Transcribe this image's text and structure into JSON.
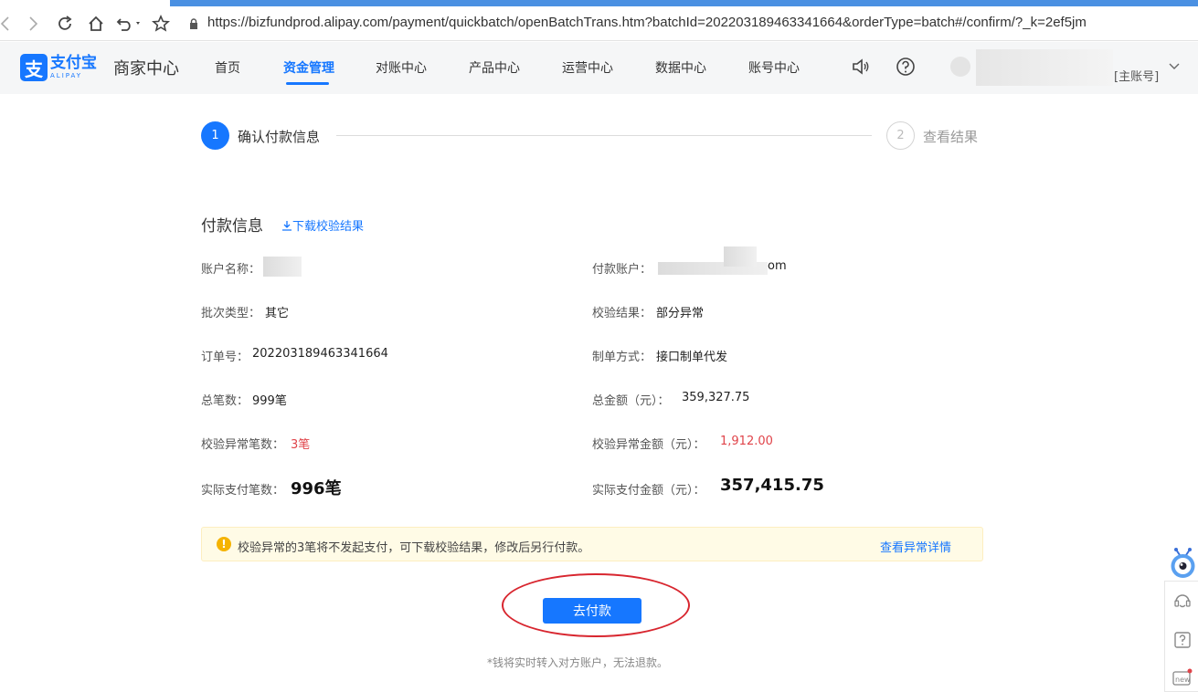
{
  "browser": {
    "url": "https://bizfundprod.alipay.com/payment/quickbatch/openBatchTrans.htm?batchId=202203189463341664&orderType=batch#/confirm/?_k=2ef5jm"
  },
  "header": {
    "logo_cn": "支付宝",
    "logo_en": "ALIPAY",
    "merchant_title": "商家中心",
    "nav": [
      "首页",
      "资金管理",
      "对账中心",
      "产品中心",
      "运营中心",
      "数据中心",
      "账号中心"
    ],
    "active_nav": "资金管理",
    "account_tag": "[主账号]"
  },
  "steps": [
    {
      "number": "1",
      "label": "确认付款信息",
      "active": true
    },
    {
      "number": "2",
      "label": "查看结果",
      "active": false
    }
  ],
  "payment_info": {
    "title": "付款信息",
    "download_link": "下载校验结果",
    "account_name_label": "账户名称：",
    "pay_account_label": "付款账户：",
    "pay_account_suffix": "om",
    "batch_type_label": "批次类型：",
    "batch_type": "其它",
    "check_result_label": "校验结果：",
    "check_result": "部分异常",
    "order_no_label": "订单号：",
    "order_no": "202203189463341664",
    "make_method_label": "制单方式：",
    "make_method": "接口制单代发",
    "total_count_label": "总笔数：",
    "total_count": "999笔",
    "total_amount_label": "总金额（元）：",
    "total_amount": "359,327.75",
    "abnormal_count_label": "校验异常笔数：",
    "abnormal_count": "3笔",
    "abnormal_amount_label": "校验异常金额（元）：",
    "abnormal_amount": "1,912.00",
    "actual_count_label": "实际支付笔数：",
    "actual_count": "996笔",
    "actual_amount_label": "实际支付金额（元）：",
    "actual_amount": "357,415.75"
  },
  "alert": {
    "text": "校验异常的3笔将不发起支付，可下载校验结果，修改后另行付款。",
    "link": "查看异常详情"
  },
  "actions": {
    "pay_button": "去付款",
    "note": "*钱将实时转入对方账户，无法退款。"
  },
  "colors": {
    "brand": "#1677ff",
    "error": "#e0444a",
    "annotation": "#d8262f"
  }
}
